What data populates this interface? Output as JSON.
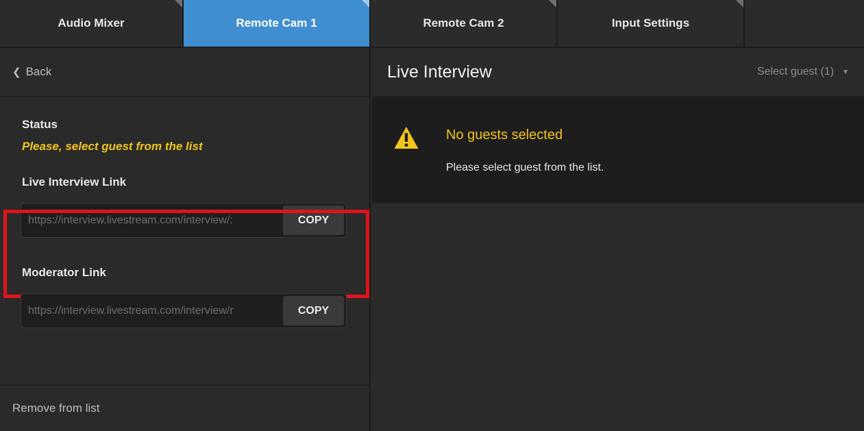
{
  "tabs": [
    {
      "label": "Audio Mixer",
      "active": false
    },
    {
      "label": "Remote Cam 1",
      "active": true
    },
    {
      "label": "Remote Cam 2",
      "active": false
    },
    {
      "label": "Input Settings",
      "active": false
    }
  ],
  "left_panel": {
    "back_label": "Back",
    "back_icon": "chevron-left-icon",
    "status_label": "Status",
    "status_message": "Please, select guest from the list",
    "live_interview_link": {
      "label": "Live Interview Link",
      "value": "https://interview.livestream.com/interview/:",
      "copy_label": "COPY"
    },
    "moderator_link": {
      "label": "Moderator Link",
      "value": "https://interview.livestream.com/interview/r",
      "copy_label": "COPY"
    },
    "remove_label": "Remove from list"
  },
  "right_panel": {
    "title": "Live Interview",
    "guest_select_label": "Select guest (1)",
    "guest_select_icon": "caret-down-icon",
    "notice": {
      "icon": "warning-icon",
      "title": "No guests selected",
      "text": "Please select guest from the list."
    }
  },
  "colors": {
    "accent_tab": "#3f8ed0",
    "warning": "#f4c51b",
    "highlight_box": "#e2121a",
    "background": "#2a2a2a"
  }
}
